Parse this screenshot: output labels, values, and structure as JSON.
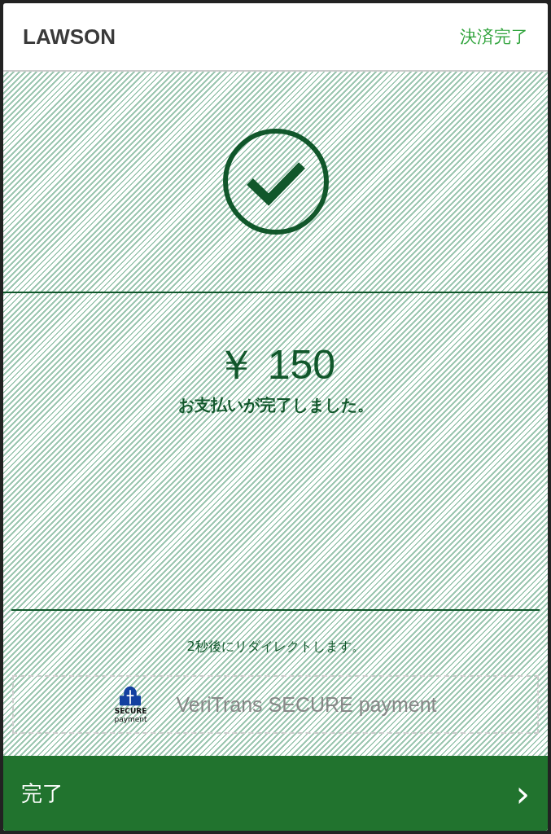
{
  "header": {
    "brand": "LAWSON",
    "status": "決済完了"
  },
  "result": {
    "amount": "￥ 150",
    "message": "お支払いが完了しました。"
  },
  "redirect_note": "2秒後にリダイレクトします。",
  "secure_badge": {
    "logo_top": "SECURE",
    "logo_bottom": "payment",
    "text": "VeriTrans SECURE payment"
  },
  "done_button": {
    "label": "完了",
    "arrow": "›"
  }
}
